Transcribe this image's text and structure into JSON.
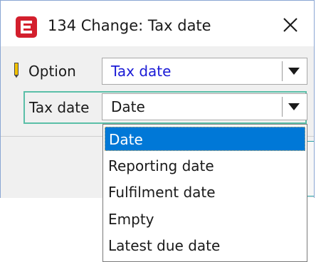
{
  "window": {
    "title": "134 Change: Tax date",
    "accent_color": "#d31f2d"
  },
  "form": {
    "option": {
      "label": "Option",
      "value": "Tax date",
      "value_color": "#1a1ad6"
    },
    "tax_date": {
      "label": "Tax date",
      "value": "Date"
    }
  },
  "dropdown": {
    "items": [
      {
        "label": "Date",
        "selected": true
      },
      {
        "label": "Reporting date",
        "selected": false
      },
      {
        "label": "Fulfilment date",
        "selected": false
      },
      {
        "label": "Empty",
        "selected": false
      },
      {
        "label": "Latest due date",
        "selected": false
      }
    ],
    "selection_color": "#0078d7"
  }
}
